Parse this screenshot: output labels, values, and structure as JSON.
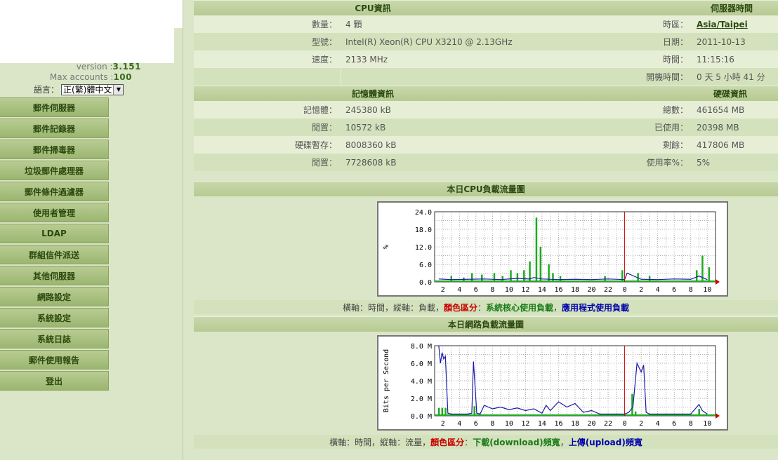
{
  "sidebar": {
    "version_label": "version :",
    "version_value": "3.151",
    "max_accounts_label": "Max accounts :",
    "max_accounts_value": "100",
    "language_label": "語言：",
    "language_selected": "正(繁)體中文",
    "menu": [
      {
        "label": "郵件伺服器"
      },
      {
        "label": "郵件記錄器"
      },
      {
        "label": "郵件掃毒器"
      },
      {
        "label": "垃圾郵件處理器"
      },
      {
        "label": "郵件條件過濾器"
      },
      {
        "label": "使用者管理"
      },
      {
        "label": "LDAP"
      },
      {
        "label": "群組信件派送"
      },
      {
        "label": "其他伺服器"
      },
      {
        "label": "網路設定"
      },
      {
        "label": "系統設定"
      },
      {
        "label": "系統日誌"
      },
      {
        "label": "郵件使用報告"
      },
      {
        "label": "登出"
      }
    ]
  },
  "cpu": {
    "title": "CPU資訊",
    "count_label": "數量：",
    "count": "4 顆",
    "model_label": "型號：",
    "model": "Intel(R) Xeon(R) CPU X3210 @ 2.13GHz",
    "speed_label": "速度：",
    "speed": "2133 MHz"
  },
  "server_time": {
    "title": "伺服器時間",
    "tz_label": "時區：",
    "tz": "Asia/Taipei",
    "date_label": "日期：",
    "date": "2011-10-13",
    "time_label": "時間：",
    "time": "11:15:16",
    "uptime_label": "開機時間：",
    "uptime": "0 天 5 小時 41 分"
  },
  "memory": {
    "title": "記憶體資訊",
    "mem_label": "記憶體：",
    "mem": "245380 kB",
    "free_label": "閒置：",
    "free": "10572 kB",
    "swap_label": "硬碟暫存：",
    "swap": "8008360 kB",
    "swap_free_label": "閒置：",
    "swap_free": "7728608 kB"
  },
  "disk": {
    "title": "硬碟資訊",
    "total_label": "總數：",
    "total": "461654 MB",
    "used_label": "已使用：",
    "used": "20398 MB",
    "left_label": "剩餘：",
    "left": "417806 MB",
    "pct_label": "使用率%：",
    "pct": "5%"
  },
  "cpu_chart_title": "本日CPU負載流量圖",
  "cpu_legend": {
    "axes": "橫軸：時間，縱軸：負載，",
    "color": "顏色區分",
    "colon": "：",
    "green": "系統核心使用負載",
    "comma": "，",
    "blue": "應用程式使用負載"
  },
  "net_chart_title": "本日網路負載流量圖",
  "net_legend": {
    "axes": "橫軸：時間，縱軸：流量，",
    "color": "顏色區分",
    "colon": "：",
    "green": "下載(download)頻寬",
    "comma": "，",
    "blue": "上傳(upload)頻寬"
  },
  "colors": {
    "green": "#1faa1f",
    "blue": "#1a1aa8",
    "now_line": "#cc0000"
  },
  "chart_data": [
    {
      "type": "area",
      "title": "",
      "ylabel": "%",
      "ylim": [
        0,
        24
      ],
      "yticks": [
        "0.0",
        "6.0",
        "12.0",
        "18.0",
        "24.0"
      ],
      "xticks": [
        "2",
        "4",
        "6",
        "8",
        "10",
        "12",
        "14",
        "16",
        "18",
        "20",
        "22",
        "0",
        "2",
        "4",
        "6",
        "8",
        "10"
      ],
      "grid": true,
      "series": [
        {
          "name": "系統核心使用負載",
          "color": "green",
          "x": [
            3,
            4.5,
            5.5,
            6.7,
            8.2,
            9.2,
            10.2,
            11,
            11.8,
            12.5,
            13.3,
            13.8,
            14.8,
            15.3,
            16.2,
            21.6,
            23.7,
            25.6,
            27,
            32.7,
            33.4,
            34.2
          ],
          "y": [
            2,
            1.5,
            3,
            2.5,
            3,
            2,
            4,
            3,
            4,
            7,
            22,
            12,
            6,
            3,
            2,
            2,
            4,
            3,
            2,
            4,
            9,
            5
          ]
        },
        {
          "name": "應用程式使用負載",
          "color": "blue",
          "x": [
            1.5,
            3,
            5,
            7,
            9,
            11,
            12.5,
            13,
            14,
            16,
            18,
            20,
            22,
            24,
            24.3,
            26,
            28,
            30,
            32,
            33,
            34
          ],
          "y": [
            1,
            0.8,
            0.9,
            1,
            0.8,
            1.2,
            1,
            1.5,
            1,
            0.8,
            0.9,
            0.8,
            1,
            0.8,
            3,
            0.9,
            0.8,
            1,
            0.9,
            2,
            0.8
          ]
        }
      ]
    },
    {
      "type": "line",
      "title": "",
      "ylabel": "Bits per Second",
      "ylim": [
        0,
        8
      ],
      "yticks": [
        "0.0 M",
        "2.0 M",
        "4.0 M",
        "6.0 M",
        "8.0 M"
      ],
      "xticks": [
        "2",
        "4",
        "6",
        "8",
        "10",
        "12",
        "14",
        "16",
        "18",
        "20",
        "22",
        "0",
        "2",
        "4",
        "6",
        "8",
        "10"
      ],
      "grid": true,
      "series": [
        {
          "name": "下載(download)頻寬",
          "color": "green",
          "x": [
            1.5,
            1.9,
            2.3,
            2.5,
            5.5,
            5.8,
            24.6,
            24.9,
            25.3,
            32.5,
            33,
            34
          ],
          "y": [
            0.9,
            0.9,
            0.9,
            0.1,
            0.1,
            1.1,
            0.1,
            2.5,
            0.5,
            0.1,
            0.8,
            0.1
          ]
        },
        {
          "name": "上傳(upload)頻寬",
          "color": "blue",
          "x": [
            1.5,
            1.7,
            1.9,
            2.1,
            2.3,
            2.6,
            3,
            4,
            5,
            5.5,
            5.7,
            6.1,
            6.5,
            7,
            8,
            9,
            10,
            11,
            12,
            13,
            14,
            14.5,
            15,
            16,
            17,
            18,
            19,
            20,
            21,
            24,
            24.5,
            25,
            25.5,
            26,
            26.3,
            26.6,
            27,
            28,
            32,
            33,
            33.4,
            34
          ],
          "y": [
            8,
            6,
            7.2,
            6.5,
            6.8,
            0.3,
            0.2,
            0.2,
            0.2,
            0.3,
            6.2,
            0.3,
            0.2,
            1.2,
            0.8,
            1.0,
            0.7,
            0.9,
            0.6,
            0.8,
            0.3,
            1.2,
            0.6,
            1.6,
            1.0,
            1.4,
            0.4,
            0.6,
            0.2,
            0.2,
            0.4,
            1.0,
            6.0,
            5.0,
            5.8,
            0.4,
            0.2,
            0.2,
            0.2,
            1.3,
            0.6,
            0.2
          ]
        }
      ]
    }
  ]
}
